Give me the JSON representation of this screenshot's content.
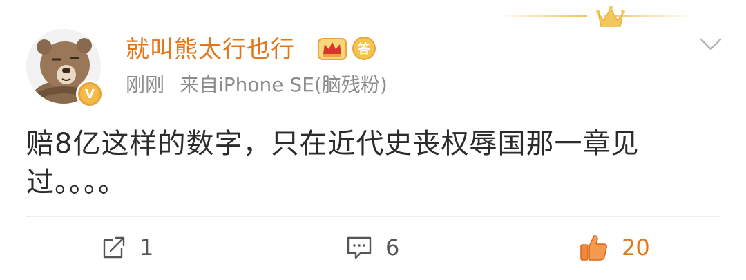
{
  "post": {
    "username": "就叫熊太行也行",
    "time": "刚刚",
    "source": "来自iPhone SE(脑残粉)",
    "text_line1": "赔8亿这样的数字，只在近代史丧权辱国那一章见",
    "text_line2": "过。。。。"
  },
  "actions": {
    "repost_count": "1",
    "comment_count": "6",
    "like_count": "20"
  },
  "icons": {
    "avatar": "bear-avatar",
    "verified_badge": "verified-badge-icon",
    "vip": "crown-vip-icon",
    "fan_badge": "fan-badge-icon",
    "menu": "chevron-down-icon",
    "repost": "repost-icon",
    "comment": "comment-icon",
    "like": "thumbs-up-icon"
  },
  "verified_badge_text": "V",
  "fan_badge_text": "答",
  "colors": {
    "username": "#e4761b",
    "meta": "#8c8c8c",
    "like_active": "#e4761b",
    "badge": "#f5b945"
  }
}
